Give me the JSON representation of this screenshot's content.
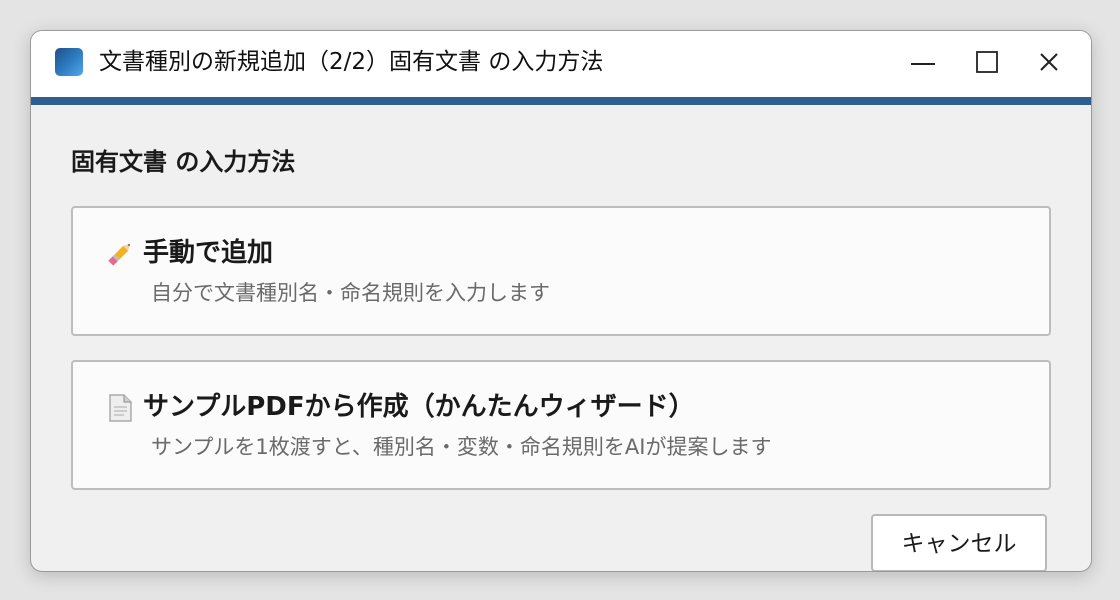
{
  "window": {
    "title": "文書種別の新規追加（2/2）固有文書 の入力方法",
    "app_icon": "app-icon",
    "controls": [
      "minimize-icon",
      "maximize-icon",
      "close-icon"
    ]
  },
  "main": {
    "heading": "固有文書 の入力方法",
    "options": [
      {
        "icon": "pencil-icon",
        "label": "手動で追加",
        "description": "自分で文書種別名・命名規則を入力します"
      },
      {
        "icon": "document-icon",
        "label": "サンプルPDFから作成（かんたんウィザード）",
        "description": "サンプルを1枚渡すと、種別名・変数・命名規則をAIが提案します"
      }
    ]
  },
  "footer": {
    "cancel_label": "キャンセル"
  },
  "colors": {
    "accent": "#2d5f8f",
    "card_border": "#bdbdbd",
    "background": "#f0f0f0"
  }
}
